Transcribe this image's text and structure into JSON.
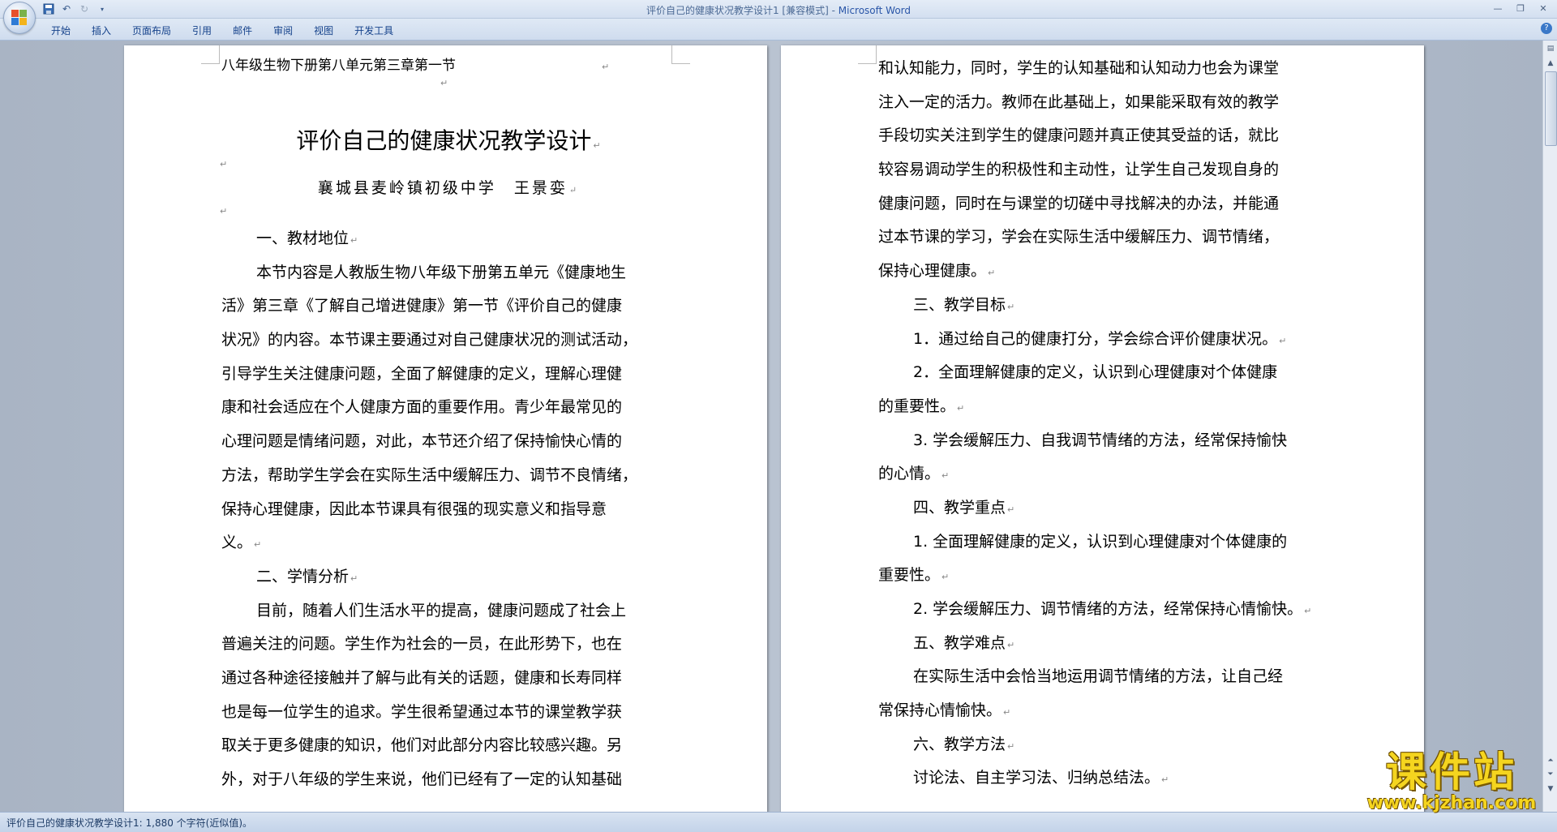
{
  "window": {
    "title": "评价自己的健康状况教学设计1 [兼容模式] - ",
    "app": "Microsoft Word"
  },
  "ribbon": {
    "tabs": [
      "开始",
      "插入",
      "页面布局",
      "引用",
      "邮件",
      "审阅",
      "视图",
      "开发工具"
    ]
  },
  "document": {
    "left_page": {
      "header": "八年级生物下册第八单元第三章第一节",
      "title": "评价自己的健康状况教学设计",
      "author": "襄城县麦岭镇初级中学　王景娈",
      "section1_heading": "一、教材地位",
      "para1": [
        "本节内容是人教版生物八年级下册第五单元《健康地生",
        "活》第三章《了解自己增进健康》第一节《评价自己的健康",
        "状况》的内容。本节课主要通过对自己健康状况的测试活动，",
        "引导学生关注健康问题，全面了解健康的定义，理解心理健",
        "康和社会适应在个人健康方面的重要作用。青少年最常见的",
        "心理问题是情绪问题，对此，本节还介绍了保持愉快心情的",
        "方法，帮助学生学会在实际生活中缓解压力、调节不良情绪，",
        "保持心理健康，因此本节课具有很强的现实意义和指导意",
        "义。"
      ],
      "section2_heading": "二、学情分析",
      "para2": [
        "目前，随着人们生活水平的提高，健康问题成了社会上",
        "普遍关注的问题。学生作为社会的一员，在此形势下，也在",
        "通过各种途径接触并了解与此有关的话题，健康和长寿同样",
        "也是每一位学生的追求。学生很希望通过本节的课堂教学获",
        "取关于更多健康的知识，他们对此部分内容比较感兴趣。另",
        "外，对于八年级的学生来说，他们已经有了一定的认知基础"
      ]
    },
    "right_page": {
      "para_cont": [
        "和认知能力，同时，学生的认知基础和认知动力也会为课堂",
        "注入一定的活力。教师在此基础上，如果能采取有效的教学",
        "手段切实关注到学生的健康问题并真正使其受益的话，就比",
        "较容易调动学生的积极性和主动性，让学生自己发现自身的",
        "健康问题，同时在与课堂的切磋中寻找解决的办法，并能通",
        "过本节课的学习，学会在实际生活中缓解压力、调节情绪，",
        "保持心理健康。"
      ],
      "section3_heading": "三、教学目标",
      "goal1": "1．通过给自己的健康打分，学会综合评价健康状况。",
      "goal2": [
        "2．全面理解健康的定义，认识到心理健康对个体健康",
        "的重要性。"
      ],
      "goal3": [
        "3. 学会缓解压力、自我调节情绪的方法，经常保持愉快",
        "的心情。"
      ],
      "section4_heading": "四、教学重点",
      "key1": [
        "1. 全面理解健康的定义，认识到心理健康对个体健康的",
        "重要性。"
      ],
      "key2": "2. 学会缓解压力、调节情绪的方法，经常保持心情愉快。",
      "section5_heading": "五、教学难点",
      "difficulty": [
        "在实际生活中会恰当地运用调节情绪的方法，让自己经",
        "常保持心情愉快。"
      ],
      "section6_heading": "六、教学方法",
      "methods": "讨论法、自主学习法、归纳总结法。"
    }
  },
  "statusbar": {
    "text": "评价自己的健康状况教学设计1: 1,880 个字符(近似值)。"
  },
  "watermark": {
    "main": "课件站",
    "sub": "www.kjzhan.com"
  },
  "colors": {
    "ribbon_text": "#15428b",
    "workspace": "#b3bdcb",
    "watermark": "#f5d51f"
  }
}
